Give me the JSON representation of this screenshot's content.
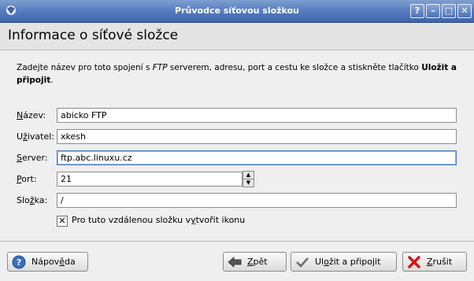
{
  "window": {
    "title": "Průvodce síťovou složkou"
  },
  "titlebar_buttons": {
    "help": "?",
    "minimize": "–",
    "maximize": "□",
    "close": "✕"
  },
  "header": {
    "title": "Informace o síťové složce"
  },
  "intro": {
    "part1": "Zadejte název pro toto spojení s ",
    "ftp": "FTP",
    "part2": " serverem, adresu, port a cestu ke složce a stiskněte tlačítko ",
    "bold_line1": "Uložit a",
    "bold_line2": "připojit",
    "end": "."
  },
  "form": {
    "name": {
      "label_u": "N",
      "label_rest": "ázev:",
      "value": "abicko FTP"
    },
    "user": {
      "label_a": "U",
      "label_u": "ž",
      "label_rest": "ivatel:",
      "value": "xkesh"
    },
    "server": {
      "label_u": "S",
      "label_rest": "erver:",
      "value": "ftp.abc.linuxu.cz"
    },
    "port": {
      "label_u": "P",
      "label_rest": "ort:",
      "value": "21"
    },
    "folder": {
      "label_a": "Slo",
      "label_u": "ž",
      "label_rest": "ka:",
      "value": "/"
    },
    "create_icon": {
      "checked": true,
      "label_a": "Pro tuto vzdálenou složku v",
      "label_u": "y",
      "label_rest": "tvořit ikonu"
    }
  },
  "buttons": {
    "help": {
      "a": "Nápov",
      "u": "ě",
      "rest": "da"
    },
    "back": {
      "u": "Z",
      "rest": "pět"
    },
    "save": {
      "a": "Ul",
      "u": "o",
      "rest": "žit a připojit"
    },
    "cancel": {
      "u": "Z",
      "rest": "rušit"
    }
  },
  "colors": {
    "titlebar": "#4a6fb5",
    "focus": "#4a78c8"
  }
}
